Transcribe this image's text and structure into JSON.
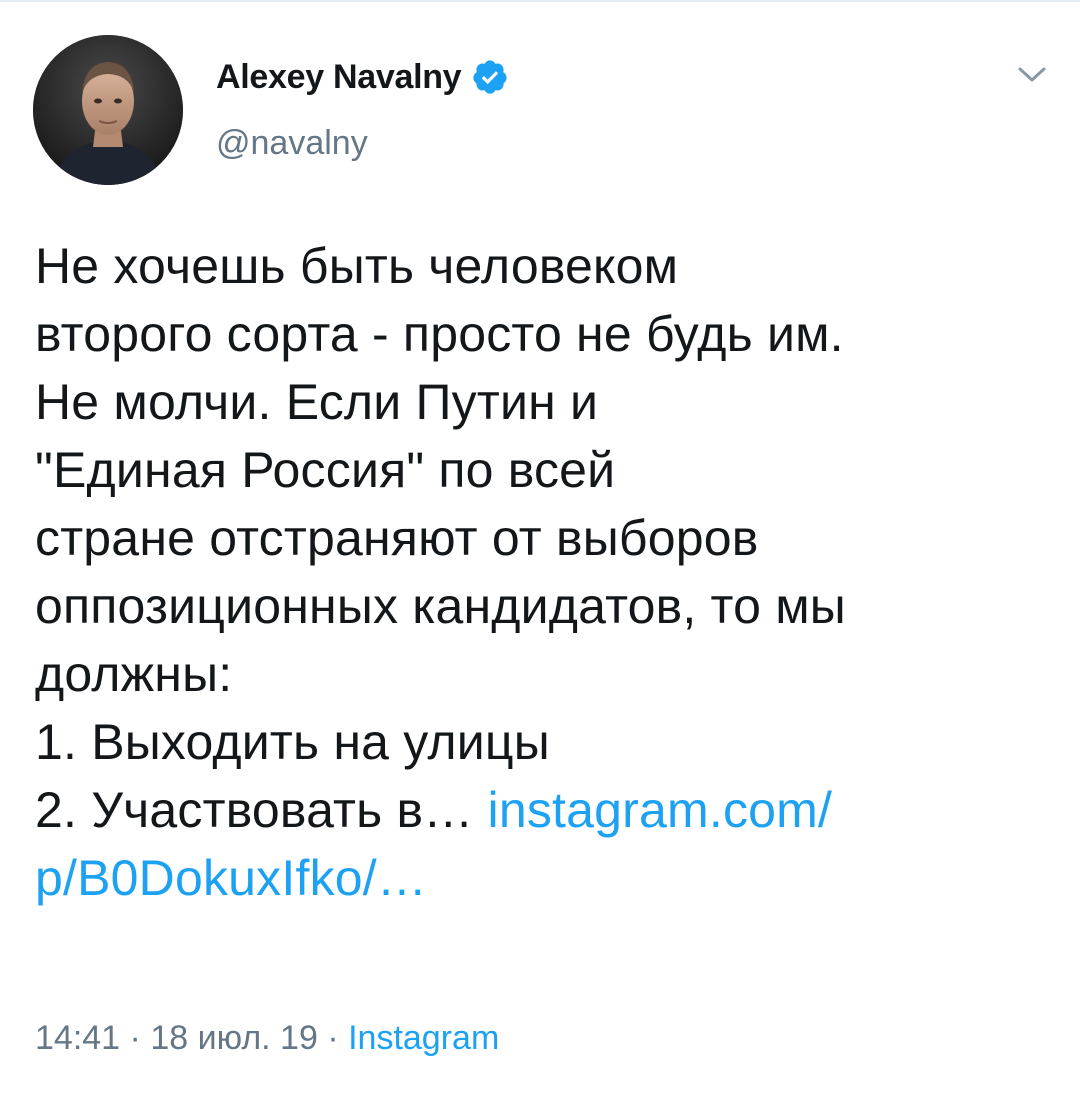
{
  "author": {
    "display_name": "Alexey Navalny",
    "handle": "@navalny",
    "verified": true,
    "avatar_icon": "profile-photo"
  },
  "tweet": {
    "lines": [
      "Не хочешь быть человеком",
      "второго сорта - просто не будь им.",
      "Не молчи. Если Путин и",
      "\"Единая Россия\" по всей",
      "стране отстраняют от выборов",
      "оппозиционных кандидатов, то мы",
      "должны:",
      "1. Выходить на улицы"
    ],
    "last_line_text": "2. Участвовать в… ",
    "link_part1": "instagram.com/",
    "link_part2": "p/B0DokuxIfko/…"
  },
  "meta": {
    "time": "14:41",
    "separator": " · ",
    "date": "18 июл. 19",
    "source": "Instagram"
  },
  "colors": {
    "link": "#1da1f2",
    "secondary_text": "#657786",
    "primary_text": "#14171a"
  },
  "icons": {
    "verified": "verified-badge-icon",
    "menu": "chevron-down-icon"
  }
}
